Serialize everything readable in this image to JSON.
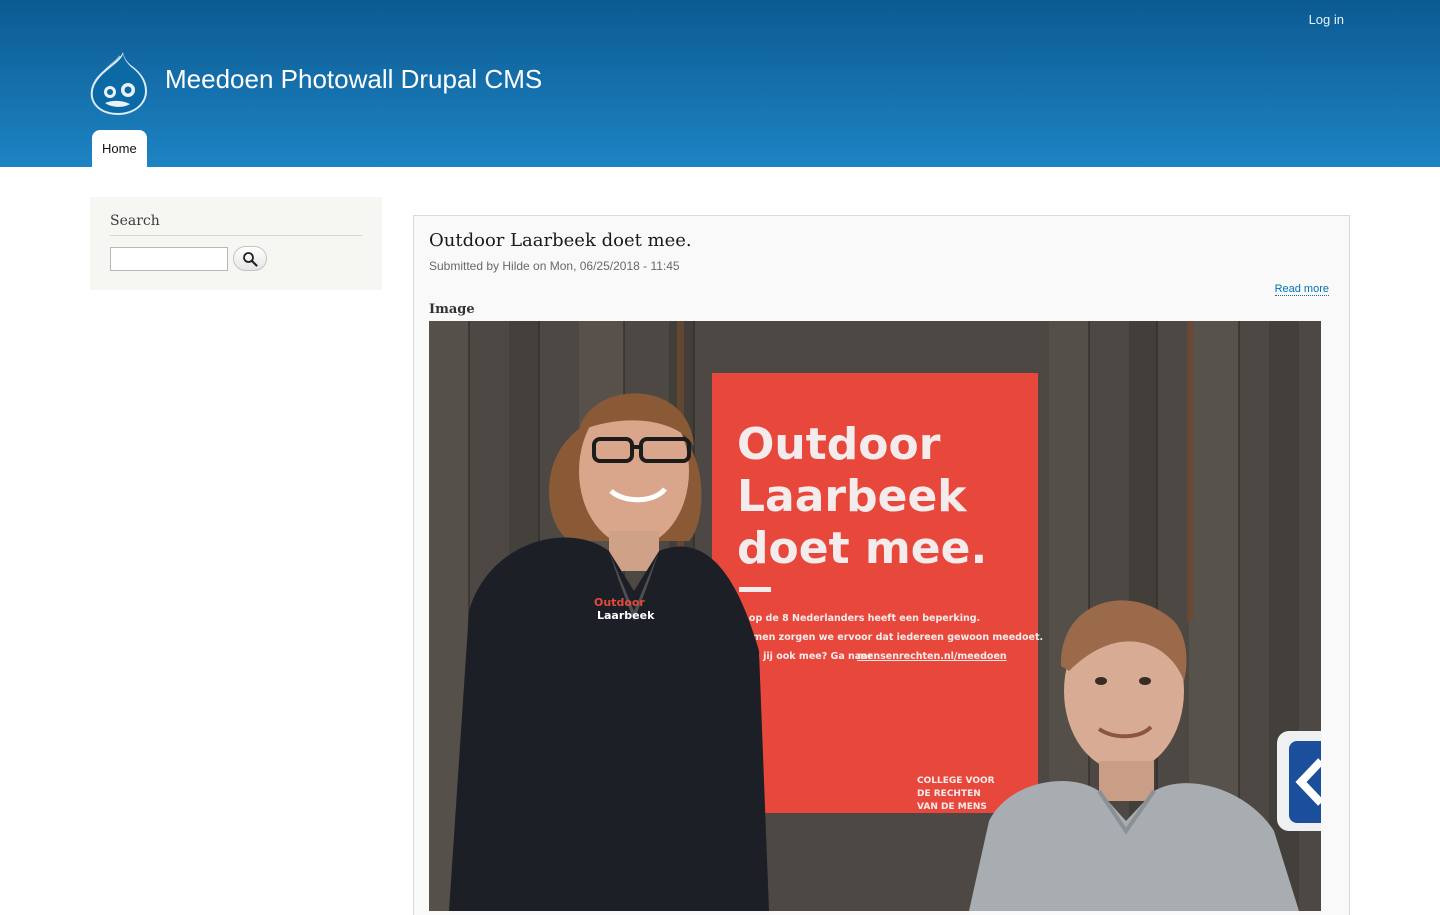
{
  "header": {
    "login": "Log in",
    "site_name": "Meedoen Photowall Drupal CMS",
    "tabs": [
      {
        "label": "Home"
      }
    ]
  },
  "sidebar": {
    "search": {
      "title": "Search",
      "input_value": "",
      "button_icon": "search-icon"
    }
  },
  "node": {
    "title": "Outdoor Laarbeek doet mee.",
    "submitted": "Submitted by Hilde on Mon, 06/25/2018 - 11:45",
    "read_more": "Read more",
    "field_label": "Image",
    "poster": {
      "line1": "Outdoor",
      "line2": "Laarbeek",
      "line3": "doet mee.",
      "body1": "1 op de 8 Nederlanders heeft een beperking.",
      "body2": "Samen zorgen we ervoor dat iedereen gewoon meedoet.",
      "body3": "Doe jij ook mee? Ga naar",
      "body3_link": "mensenrechten.nl/meedoen",
      "org1": "COLLEGE VOOR",
      "org2": "DE RECHTEN",
      "org3": "VAN DE MENS"
    },
    "jacket_text1": "Outdoor",
    "jacket_text2": "Laarbeek"
  },
  "colors": {
    "header_top": "#0c5a92",
    "header_bottom": "#1d84c3",
    "poster_red": "#e8483c",
    "link": "#0071b3"
  }
}
